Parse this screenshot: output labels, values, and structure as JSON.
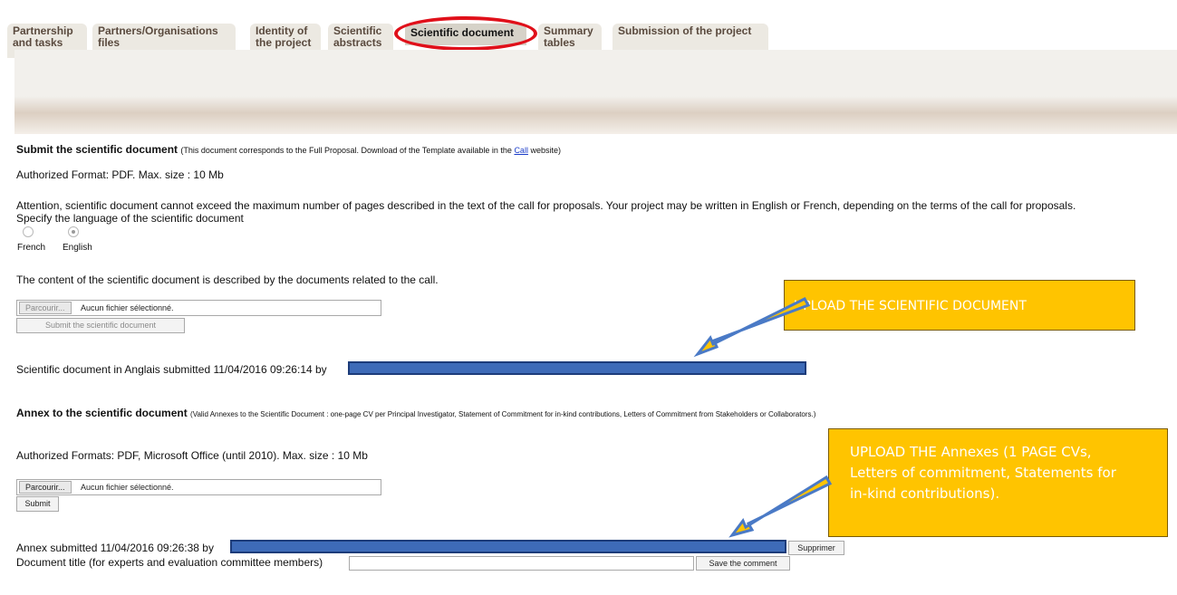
{
  "tabs": [
    {
      "label": "Partnership\nand tasks",
      "active": false
    },
    {
      "label": "Partners/Organisations\nfiles",
      "active": false
    },
    {
      "label": "Identity of\nthe project",
      "active": false
    },
    {
      "label": "Scientific\nabstracts",
      "active": false
    },
    {
      "label": "Scientific document",
      "active": true
    },
    {
      "label": "Summary\ntables",
      "active": false
    },
    {
      "label": "Submission of the project",
      "active": false
    }
  ],
  "scientific": {
    "heading": "Submit the scientific document",
    "note_prefix": "(This document corresponds to the Full Proposal. Download of the Template available in the",
    "note_link": "Call",
    "note_suffix": "website)",
    "format": "Authorized Format: PDF. Max. size : 10 Mb",
    "attention": "Attention, scientific document cannot exceed the maximum number of pages described in the text of the call for proposals. Your project may be written in English or French, depending on the terms of the call for proposals.",
    "language_prompt": "Specify the language of the scientific document",
    "languages": [
      "French",
      "English"
    ],
    "selected_language": "English",
    "content_note": "The content of the scientific document is described by the documents related to the call.",
    "browse_label": "Parcourir...",
    "no_file_label": "Aucun fichier sélectionné.",
    "submit_label": "Submit the scientific document",
    "submitted_text": "Scientific document in Anglais submitted 11/04/2016 09:26:14 by"
  },
  "annex": {
    "heading": "Annex to the scientific document",
    "note": "(Valid Annexes to the Scientific Document : one-page CV per Principal Investigator, Statement of Commitment for in-kind contributions, Letters of Commitment from Stakeholders or Collaborators.)",
    "format": "Authorized Formats: PDF, Microsoft Office (until 2010). Max. size : 10 Mb",
    "browse_label": "Parcourir...",
    "no_file_label": "Aucun fichier sélectionné.",
    "submit_label": "Submit",
    "submitted_text": "Annex submitted 11/04/2016 09:26:38 by",
    "delete_label": "Supprimer",
    "title_label": "Document title (for experts and evaluation committee members)",
    "title_value": "",
    "save_label": "Save the comment"
  },
  "callouts": {
    "upload_document": "UPLOAD THE SCIENTIFIC DOCUMENT",
    "upload_annexes_line1": "UPLOAD  THE  Annexes  (1  PAGE  CVs,",
    "upload_annexes_line2": "Letters of commitment, Statements for",
    "upload_annexes_line3": "in-kind contributions)."
  },
  "colors": {
    "highlight_ring": "#e0101a",
    "callout_bg": "#ffc400",
    "redaction": "#3e6bb8",
    "link": "#1a3cc8"
  }
}
